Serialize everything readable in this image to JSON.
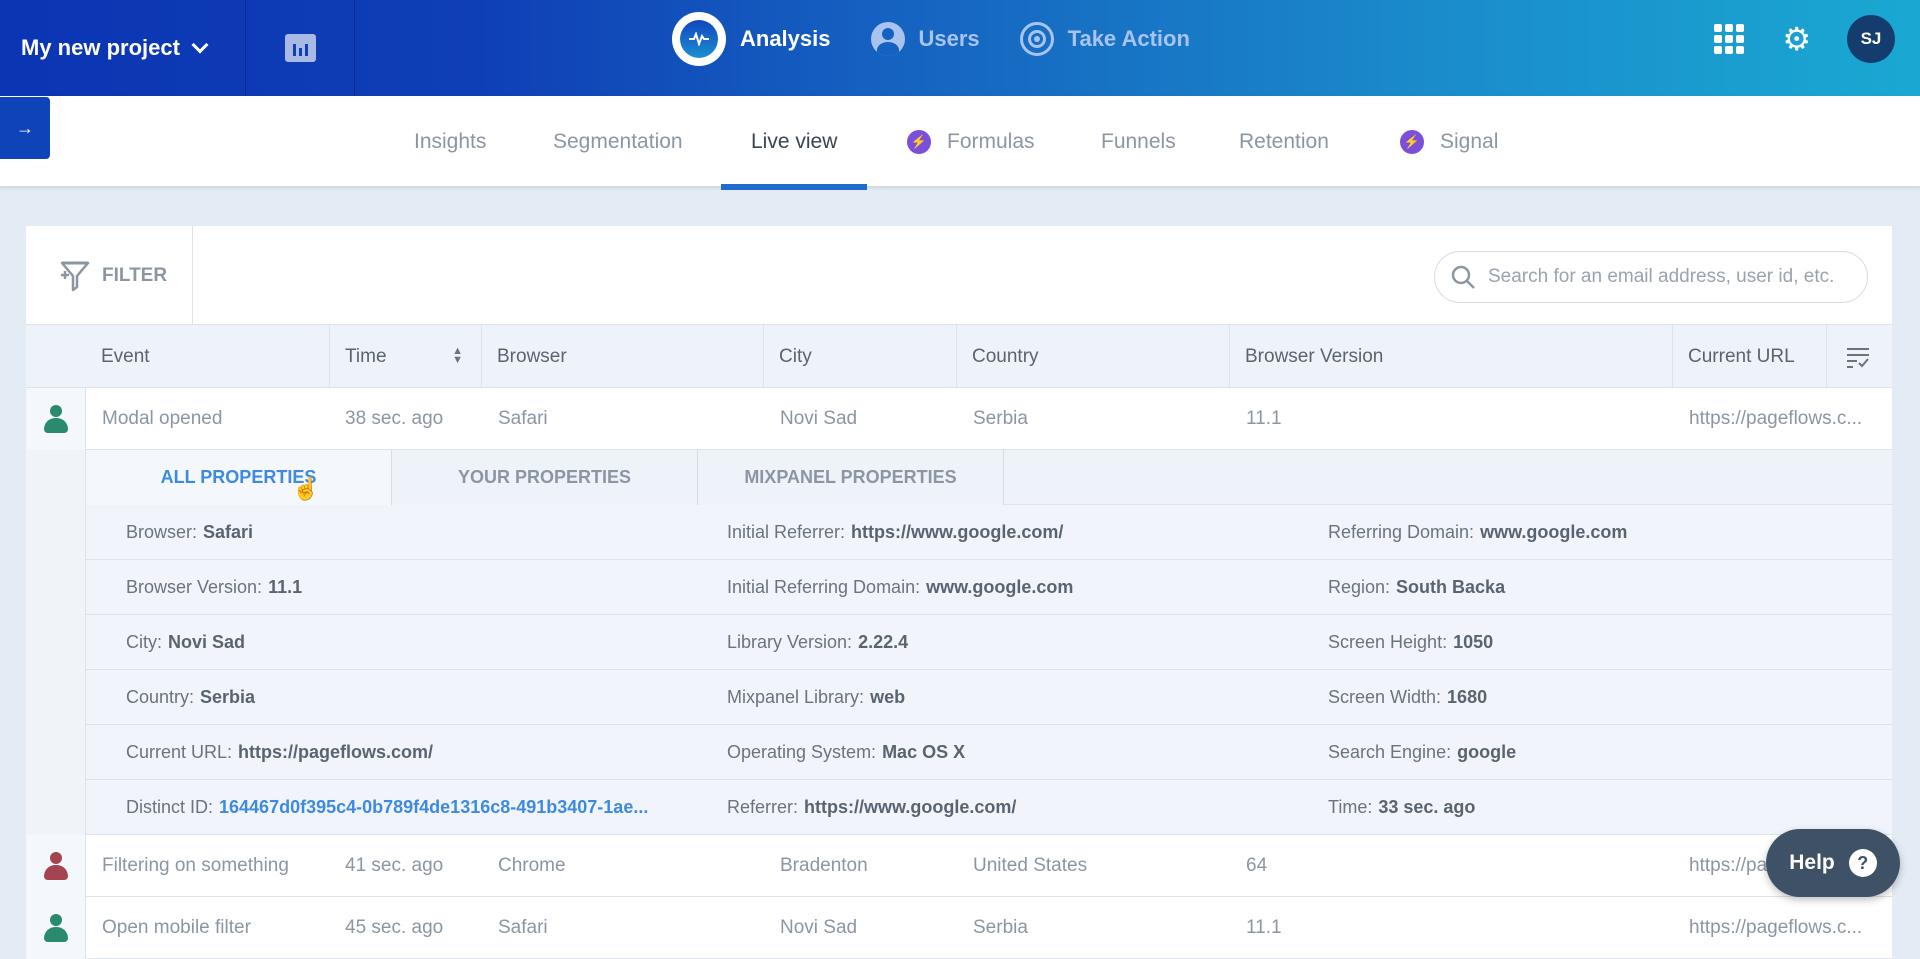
{
  "topbar": {
    "project_name": "My new project",
    "nav": [
      {
        "label": "Analysis",
        "icon": "analysis-pulse-icon",
        "active": true
      },
      {
        "label": "Users",
        "icon": "user-icon",
        "active": false
      },
      {
        "label": "Take Action",
        "icon": "target-icon",
        "active": false
      }
    ],
    "avatar_initials": "SJ"
  },
  "subnav": {
    "tabs": [
      {
        "label": "Insights",
        "active": false,
        "badge": false
      },
      {
        "label": "Segmentation",
        "active": false,
        "badge": false
      },
      {
        "label": "Live view",
        "active": true,
        "badge": false
      },
      {
        "label": "Formulas",
        "active": false,
        "badge": true
      },
      {
        "label": "Funnels",
        "active": false,
        "badge": false
      },
      {
        "label": "Retention",
        "active": false,
        "badge": false
      },
      {
        "label": "Signal",
        "active": false,
        "badge": true
      }
    ],
    "collapse_icon": "→"
  },
  "filter": {
    "label": "FILTER",
    "search_placeholder": "Search for an email address, user id, etc."
  },
  "table": {
    "columns": [
      "Event",
      "Time",
      "Browser",
      "City",
      "Country",
      "Browser Version",
      "Current URL"
    ],
    "rows": [
      {
        "user_color": "#2a8a6e",
        "event": "Modal opened",
        "time": "38 sec. ago",
        "browser": "Safari",
        "city": "Novi Sad",
        "country": "Serbia",
        "browser_version": "11.1",
        "url": "https://pageflows.c..."
      },
      {
        "user_color": "#a3444e",
        "event": "Filtering on something",
        "time": "41 sec. ago",
        "browser": "Chrome",
        "city": "Bradenton",
        "country": "United States",
        "browser_version": "64",
        "url": "https://pa..."
      },
      {
        "user_color": "#2a8a6e",
        "event": "Open mobile filter",
        "time": "45 sec. ago",
        "browser": "Safari",
        "city": "Novi Sad",
        "country": "Serbia",
        "browser_version": "11.1",
        "url": "https://pageflows.c..."
      }
    ]
  },
  "details": {
    "tabs": [
      {
        "label": "ALL PROPERTIES",
        "active": true
      },
      {
        "label": "YOUR PROPERTIES",
        "active": false
      },
      {
        "label": "MIXPANEL PROPERTIES",
        "active": false
      }
    ],
    "columns": [
      [
        {
          "key": "Browser:",
          "value": "Safari"
        },
        {
          "key": "Browser Version:",
          "value": "11.1"
        },
        {
          "key": "City:",
          "value": "Novi Sad"
        },
        {
          "key": "Country:",
          "value": "Serbia"
        },
        {
          "key": "Current URL:",
          "value": "https://pageflows.com/"
        },
        {
          "key": "Distinct ID:",
          "value": "164467d0f395c4-0b789f4de1316c8-491b3407-1ae...",
          "link": true
        }
      ],
      [
        {
          "key": "Initial Referrer:",
          "value": "https://www.google.com/"
        },
        {
          "key": "Initial Referring Domain:",
          "value": "www.google.com"
        },
        {
          "key": "Library Version:",
          "value": "2.22.4"
        },
        {
          "key": "Mixpanel Library:",
          "value": "web"
        },
        {
          "key": "Operating System:",
          "value": "Mac OS X"
        },
        {
          "key": "Referrer:",
          "value": "https://www.google.com/"
        }
      ],
      [
        {
          "key": "Referring Domain:",
          "value": "www.google.com"
        },
        {
          "key": "Region:",
          "value": "South Backa"
        },
        {
          "key": "Screen Height:",
          "value": "1050"
        },
        {
          "key": "Screen Width:",
          "value": "1680"
        },
        {
          "key": "Search Engine:",
          "value": "google"
        },
        {
          "key": "Time:",
          "value": "33 sec. ago"
        }
      ]
    ]
  },
  "help": {
    "label": "Help",
    "icon": "?"
  }
}
